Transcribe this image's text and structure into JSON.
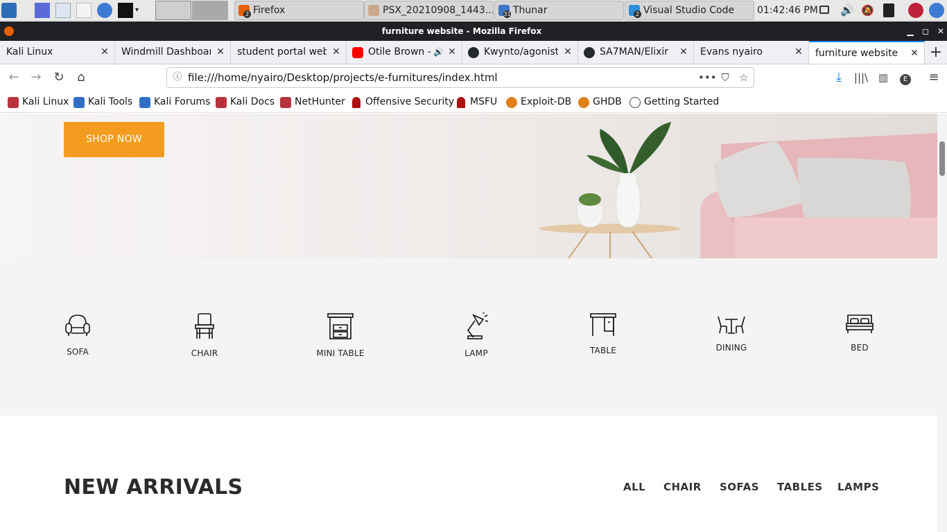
{
  "panel": {
    "tasks": [
      {
        "label": "Firefox",
        "badge": "2"
      },
      {
        "label": "PSX_20210908_1443...",
        "badge": ""
      },
      {
        "label": "Thunar",
        "badge": "31"
      },
      {
        "label": "Visual Studio Code",
        "badge": "2"
      }
    ],
    "clock": "01:42:46 PM"
  },
  "window": {
    "title": "furniture website - Mozilla Firefox"
  },
  "tabs": [
    {
      "label": "Kali Linux",
      "favicon": "none"
    },
    {
      "label": "Windmill Dashboard",
      "favicon": "none"
    },
    {
      "label": "student portal website",
      "favicon": "none"
    },
    {
      "label": "Otile Brown -",
      "favicon": "youtube-icon"
    },
    {
      "label": "Kwynto/agonist",
      "favicon": "github-icon"
    },
    {
      "label": "SA7MAN/Elixir",
      "favicon": "github-icon"
    },
    {
      "label": "Evans nyairo",
      "favicon": "none"
    },
    {
      "label": "furniture website",
      "favicon": "none"
    }
  ],
  "navbar": {
    "url": "file:///home/nyairo/Desktop/projects/e-furnitures/index.html",
    "account_initial": "E"
  },
  "bookmarks": [
    {
      "label": "Kali Linux",
      "icon": "kali-dragon-icon"
    },
    {
      "label": "Kali Tools",
      "icon": "kali-dragon-icon"
    },
    {
      "label": "Kali Forums",
      "icon": "kali-dragon-icon"
    },
    {
      "label": "Kali Docs",
      "icon": "kali-dragon-icon"
    },
    {
      "label": "NetHunter",
      "icon": "kali-dragon-icon"
    },
    {
      "label": "Offensive Security",
      "icon": "offsec-icon"
    },
    {
      "label": "MSFU",
      "icon": "offsec-icon"
    },
    {
      "label": "Exploit-DB",
      "icon": "exploitdb-icon"
    },
    {
      "label": "GHDB",
      "icon": "exploitdb-icon"
    },
    {
      "label": "Getting Started",
      "icon": "globe-icon"
    }
  ],
  "hero": {
    "button_label": "SHOP NOW"
  },
  "categories": [
    {
      "label": "SOFA",
      "icon": "sofa-icon"
    },
    {
      "label": "CHAIR",
      "icon": "chair-icon"
    },
    {
      "label": "MINI TABLE",
      "icon": "mini-table-icon"
    },
    {
      "label": "LAMP",
      "icon": "lamp-icon"
    },
    {
      "label": "TABLE",
      "icon": "table-icon"
    },
    {
      "label": "DINING",
      "icon": "dining-icon"
    },
    {
      "label": "BED",
      "icon": "bed-icon"
    }
  ],
  "arrivals": {
    "title": "NEW ARRIVALS",
    "filters": [
      "ALL",
      "CHAIR",
      "SOFAS",
      "TABLES",
      "LAMPS"
    ]
  },
  "colors": {
    "accent_orange": "#f39c1f",
    "firefox_blue": "#0a84ff",
    "sofa_pink": "#e8bfc3"
  }
}
